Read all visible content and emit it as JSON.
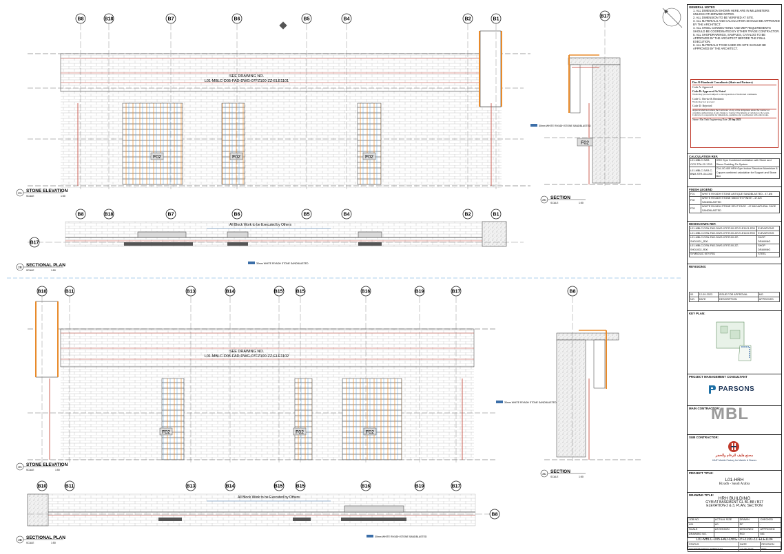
{
  "elevation_top": {
    "grid_labels": [
      "B8",
      "B18",
      "B7",
      "B6",
      "B5",
      "B4",
      "B2",
      "B1"
    ],
    "see_drawing_line1": "SEE DRAWING NO.",
    "see_drawing_line2": "L01-MBLC-D05-FAD-DWG-07FZ100-ZZ-ELE1101",
    "finish_tags": [
      "F02",
      "F02",
      "F02"
    ],
    "title_number": "2A",
    "title": "STONE ELEVATION",
    "scale_label": "SCALE",
    "scale": "1:50"
  },
  "section_top": {
    "grid_label": "B17",
    "finish_tag": "F02",
    "note": "30mm WHITE RIYADH STONE SANDBLASTED",
    "title_number": "2C",
    "title": "SECTION",
    "scale_label": "SCALE",
    "scale": "1:50"
  },
  "plan_top": {
    "grid_labels": [
      "B8",
      "B18",
      "B7",
      "B6",
      "B5",
      "B4",
      "B2",
      "B1"
    ],
    "side_grid": "B17",
    "block_note": "All Block Work to be Executed by Others",
    "stone_note": "30mm WHITE RIYADH STONE SANDBLASTED",
    "title_number": "2B",
    "title": "SECTIONAL PLAN",
    "scale_label": "SCALE",
    "scale": "1:50"
  },
  "elevation_bottom": {
    "grid_labels": [
      "B10",
      "B11",
      "B13",
      "B14",
      "B15'",
      "B15",
      "B16",
      "B19",
      "B17"
    ],
    "see_drawing_line1": "SEE DRAWING NO.",
    "see_drawing_line2": "L01-MBLC-D05-FAD-DWG-07FZ100-ZZ-ELE1102",
    "finish_tags": [
      "F02",
      "F02",
      "F02"
    ],
    "note": "30mm WHITE RIYADH STONE SANDBLASTED",
    "title_number": "3A",
    "title": "STONE ELEVATION",
    "scale_label": "SCALE",
    "scale": "1:50"
  },
  "section_bottom": {
    "grid_label": "B8",
    "title_number": "3C",
    "title": "SECTION",
    "scale_label": "SCALE",
    "scale": "1:50"
  },
  "plan_bottom": {
    "grid_labels": [
      "B10",
      "B11",
      "B13",
      "B14",
      "B15'",
      "B15",
      "B16",
      "B19",
      "B17"
    ],
    "side_grid": "B8",
    "block_note": "All Block Work to be Executed by Others",
    "stone_note": "30mm WHITE RIYADH STONE SANDBLASTED",
    "title_number": "3B",
    "title": "SECTIONAL PLAN",
    "scale_label": "SCALE",
    "scale": "1:50"
  },
  "title_block": {
    "general_notes_title": "GENERAL NOTES",
    "general_notes": [
      "1.  ALL DIMENSION SHOWN HERE ARE IN MILLIMETERS UNLESS OTHERWISE NOTED.",
      "2.  ALL DIMENSION TO BE VERIFIED AT SITE.",
      "3.  ALL MATERIALS AND CALCULATION SHOULD BE APPROVED BY THE ARCHITECT.",
      "4.  ALL STEEL CONNECTIONS AND MEP REQUIREMENTS SHOULD BE COORDINATED BY OTHER TRADE CONTRACTOR.",
      "5.  ALL SHOPDRAWINGS, SAMPLES, CATALOG TO BE APPROVED BY THE ARCHITECT BEFORE THE FINAL EXECUTION.",
      "6.  ALL MATERIALS TO BE USED ON SITE SHOULD BE APPROVED BY THE ARCHITECT."
    ],
    "stamp": {
      "header": "Dar Al-Handasah Consultants (Shair and Partners)",
      "codes": [
        "Code A:  Approved",
        "Code B:  Approved As Noted",
        "Code C:  Revise & Resubmit",
        "Code D:  Rejected"
      ],
      "code_b_note": "Work may proceed subject to incorporation of indicated comments.",
      "code_c_note": "Work may not proceed",
      "disclaimer": "Approval shall not relieve the Contractor of any of his obligations under the Contract or constitute authorization of any change to Contract Documents or variation to the works. Contractor is responsible for dimensions, quantities and coordination with other trades.",
      "name_label": "Name:",
      "name": "Mai Nabi Engineering",
      "date_label": "Date:",
      "date": "28 Sep 2023"
    },
    "calc_ref_title": "CALCULATION  REF.",
    "calc_rows": [
      [
        "L01-MBLC-SAR-CCS-TPA-22-1703",
        "HRH Gym Combined ventilation with Stone and Stone Cladding Fix System"
      ],
      [
        "L01-MBLC-SAR-C-BNM-STR-G4-D60",
        "CAL-00-400 HRH Gym Indoor Structure Aluminium & Copper combined calculation for Support and Stone Box"
      ]
    ],
    "finish_legend_title": "FINISH LEGEND",
    "finish_legend": [
      [
        "F01",
        "WHITE RIYADH STONE ANTIQUE SANDBLASTED - 47.8/6"
      ],
      [
        "F02",
        "WHITE RIYADH STONE SMOOTH FINISH - 47.8/6 SANDBLASTED"
      ],
      [
        "F03",
        "WHITE RIYADH STONE SPLIT FACE - 47.8/6 NATURAL FACE SANDBLASTED"
      ]
    ],
    "design_ref_title": "DESIGN  DWG  REF.",
    "design_rows": [
      [
        "L01-MBLC-DSN-FAD-DWG-07FZ100-ZZ-ELE1101-R00",
        "ELEVATIONS"
      ],
      [
        "L01-MBLC-DSN-FAD-DWG-07FZ100-ZZ-ELE1102-R00",
        "ELEVATIONS"
      ],
      [
        "L01-MBLC-DSN-FAD-DWG-07FZ100-ZZ-SHD1001_R00",
        "SHOP DRAWING"
      ],
      [
        "L01-MBLC-DSN-FAD-DWG-07FZ100-ZZ-SHD1002_R00",
        "SHOP DRAWING"
      ],
      [
        "SYMBOLIC KEY-R01",
        "STEEL"
      ]
    ],
    "revisions_title": "REVISIONS:",
    "revision": {
      "no": "00",
      "date": "12-09-2023",
      "description": "ISSUE FOR APPROVAL",
      "approved": "MG"
    },
    "revision_headers": [
      "NO.",
      "DATE",
      "DESCRIPTION",
      "APPROVED"
    ],
    "key_plan_title": "KEY PLAN:",
    "pmc_title": "PROJECT MANAGEMENT CONSULTANT",
    "pmc_logo": "PARSONS",
    "main_contractor_title": "MAIN CONTRACTOR:",
    "main_contractor_logo": "MBL",
    "sub_contractor_title": "SUB CONTRACTOR:",
    "sub_contractor_arabic": "مصنع هايف للرخام والحجر",
    "sub_contractor_english": "HAIF Marble Factory for Marble & Stones",
    "project_title_label": "PROJECT TITLE:",
    "project_code": "L01-HRH",
    "project_location": "Riyadh - Saudi Arabia",
    "drawing_title_label": "DRAWING TITLE:",
    "drawing_title": "HRH BUILDING",
    "drawing_subtitle1": "GYM AT BASEMENT GL B1-B8 / B17",
    "drawing_subtitle2": "ELEVATION-2 & 3, PLAN, SECTION",
    "job_no_label": "JOB NO.",
    "job_no": "L01",
    "actual_size_label": "ACTUAL SIZE",
    "actual_size": "A0",
    "scale_label": "SCALE",
    "scale": "AS SHOWN",
    "drawn_label": "DRAWN",
    "drawn": "RF",
    "checked_label": "CHECKED",
    "checked": "-",
    "designed_label": "DESIGNED",
    "designed": "R00",
    "approved_label": "APPROVED",
    "approved": "MG",
    "drawing_no_label": "DRAWING NO.",
    "drawing_number": "L01-MBLC-D05-FAD-DWG-07FZ100-ZZ-ELE1104",
    "status_label": "STATUS",
    "date_label": "DATE",
    "revision_label": "REVISION",
    "status": "SHOPDRAWING APPROVAL",
    "status_date": "12-09-2023",
    "status_revision": "R00"
  }
}
